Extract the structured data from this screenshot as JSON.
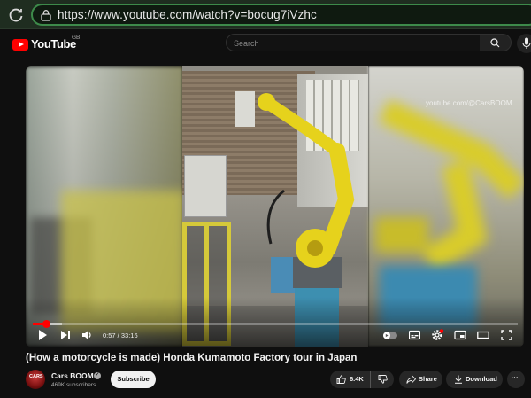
{
  "browser": {
    "url": "https://www.youtube.com/watch?v=bocug7iVzhc"
  },
  "header": {
    "logo_text": "YouTube",
    "country_code": "GB",
    "search_placeholder": "Search"
  },
  "player": {
    "watermark": "youtube.com/@CarsBOOM",
    "current_time": "0:57",
    "duration": "33:16",
    "time_display": "0:57 / 33:16",
    "progress_fraction": 0.029,
    "buffered_fraction": 0.06,
    "colors": {
      "progress": "#ff0000",
      "robot": "#e6d21c",
      "drum": "#3d8fb0"
    },
    "controls": [
      "play-icon",
      "next-icon",
      "volume-icon",
      "autoplay-toggle-icon",
      "subtitles-icon",
      "settings-icon",
      "miniplayer-icon",
      "theater-icon",
      "fullscreen-icon"
    ]
  },
  "video": {
    "title": "(How a motorcycle is made) Honda Kumamoto Factory tour in Japan"
  },
  "channel": {
    "avatar_text": "CARS",
    "name": "Cars BOOM",
    "subscribers": "469K subscribers",
    "subscribe_label": "Subscribe"
  },
  "actions": {
    "likes": "6.4K",
    "share_label": "Share",
    "download_label": "Download",
    "more_label": "···"
  }
}
